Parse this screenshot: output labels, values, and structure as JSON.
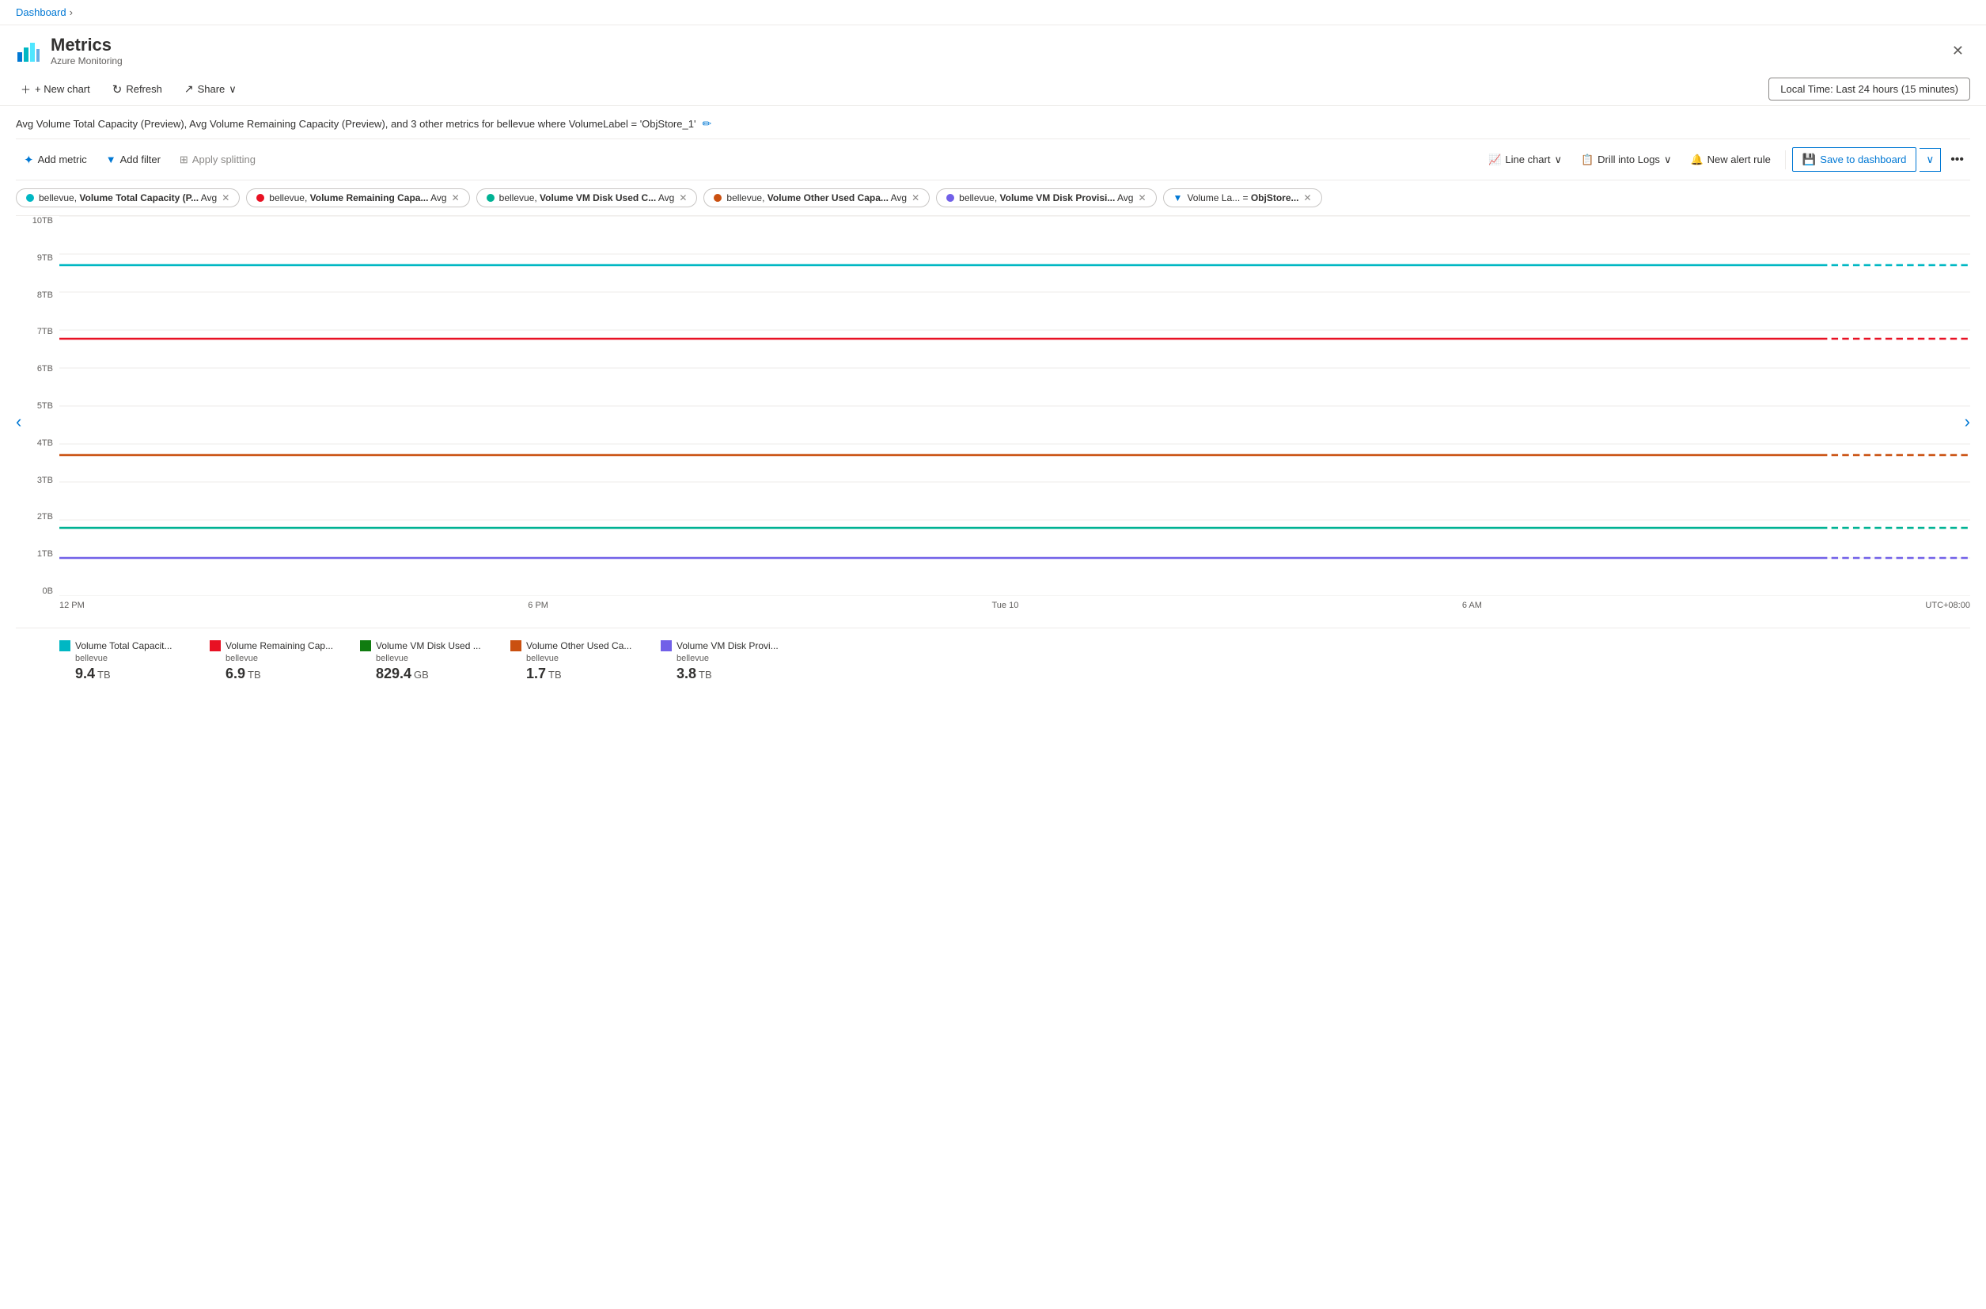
{
  "breadcrumb": {
    "label": "Dashboard",
    "chevron": "›"
  },
  "header": {
    "title": "Metrics",
    "subtitle": "Azure Monitoring",
    "close_label": "✕"
  },
  "toolbar": {
    "new_chart": "+ New chart",
    "refresh": "Refresh",
    "share": "Share",
    "share_chevron": "∨",
    "time_range": "Local Time: Last 24 hours (15 minutes)"
  },
  "chart_title": "Avg Volume Total Capacity (Preview), Avg Volume Remaining Capacity (Preview), and 3 other metrics for bellevue where VolumeLabel = 'ObjStore_1'",
  "metrics_toolbar": {
    "add_metric": "Add metric",
    "add_filter": "Add filter",
    "apply_splitting": "Apply splitting",
    "line_chart": "Line chart",
    "drill_into_logs": "Drill into Logs",
    "new_alert_rule": "New alert rule",
    "save_to_dashboard": "Save to dashboard"
  },
  "tags": [
    {
      "id": "tag1",
      "color": "blue",
      "text": "bellevue, Volume Total Capacity (P... Avg",
      "removable": true
    },
    {
      "id": "tag2",
      "color": "red",
      "text": "bellevue, Volume Remaining Capa... Avg",
      "removable": true
    },
    {
      "id": "tag3",
      "color": "green",
      "text": "bellevue, Volume VM Disk Used C... Avg",
      "removable": true
    },
    {
      "id": "tag4",
      "color": "orange",
      "text": "bellevue, Volume Other Used Capa... Avg",
      "removable": true
    },
    {
      "id": "tag5",
      "color": "purple",
      "text": "bellevue, Volume VM Disk Provisi... Avg",
      "removable": true
    },
    {
      "id": "tag6",
      "filter": true,
      "text": "Volume La... = ObjStore...",
      "removable": true
    }
  ],
  "y_axis_labels": [
    "10TB",
    "9TB",
    "8TB",
    "7TB",
    "6TB",
    "5TB",
    "4TB",
    "3TB",
    "2TB",
    "1TB",
    "0B"
  ],
  "x_axis_labels": [
    "12 PM",
    "6 PM",
    "Tue 10",
    "6 AM",
    "UTC+08:00"
  ],
  "chart_nav": {
    "left": "‹",
    "right": "›"
  },
  "chart_lines": [
    {
      "id": "total_capacity",
      "color": "#00b7c3",
      "y_pct": 87,
      "dashed_end": true
    },
    {
      "id": "remaining_capacity",
      "color": "#e81123",
      "y_pct": 69,
      "dashed_end": true
    },
    {
      "id": "other_used",
      "color": "#ca5010",
      "y_pct": 38,
      "dashed_end": true
    },
    {
      "id": "vm_disk_used",
      "color": "#00b294",
      "y_pct": 16,
      "dashed_end": true
    },
    {
      "id": "vm_disk_prov",
      "color": "#7160e8",
      "y_pct": 8,
      "dashed_end": true
    }
  ],
  "legend": [
    {
      "id": "leg1",
      "color": "#00b7c3",
      "title": "Volume Total Capacit...",
      "sub": "bellevue",
      "value": "9.4",
      "unit": "TB"
    },
    {
      "id": "leg2",
      "color": "#e81123",
      "title": "Volume Remaining Cap...",
      "sub": "bellevue",
      "value": "6.9",
      "unit": "TB"
    },
    {
      "id": "leg3",
      "color": "#107c10",
      "title": "Volume VM Disk Used ...",
      "sub": "bellevue",
      "value": "829.4",
      "unit": "GB"
    },
    {
      "id": "leg4",
      "color": "#ca5010",
      "title": "Volume Other Used Ca...",
      "sub": "bellevue",
      "value": "1.7",
      "unit": "TB"
    },
    {
      "id": "leg5",
      "color": "#7160e8",
      "title": "Volume VM Disk Provi...",
      "sub": "bellevue",
      "value": "3.8",
      "unit": "TB"
    }
  ]
}
